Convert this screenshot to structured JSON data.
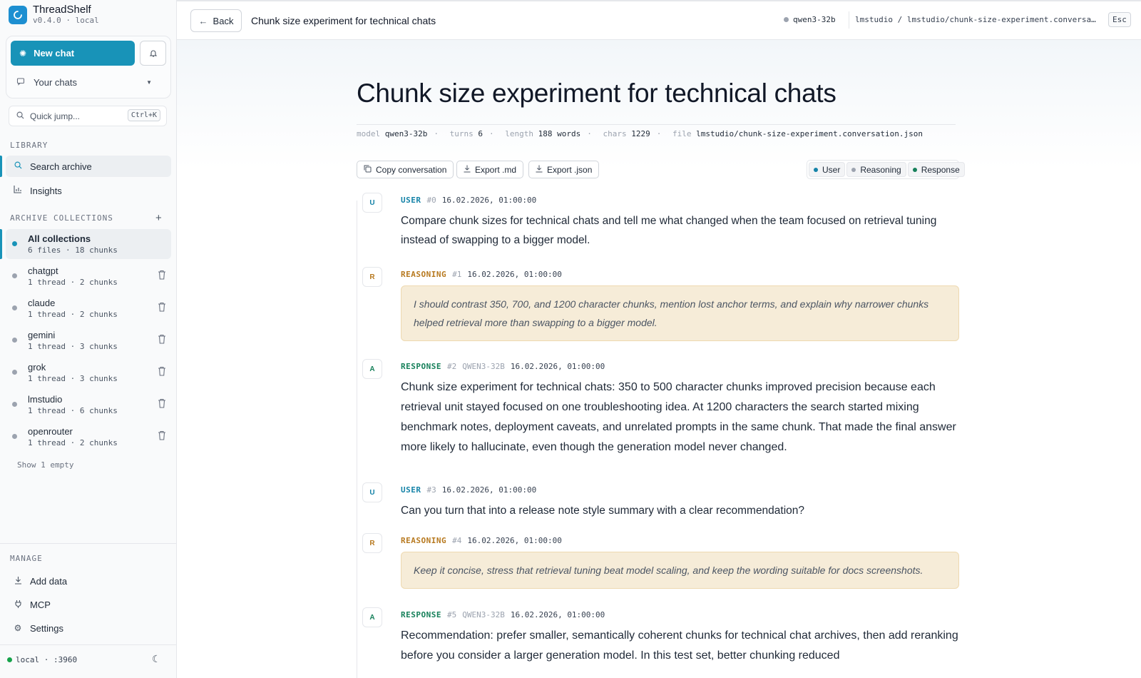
{
  "app": {
    "name": "ThreadShelf",
    "version": "v0.4.0 · local"
  },
  "sidebar": {
    "new_chat": "New chat",
    "your_chats": "Your chats",
    "quick_jump": {
      "placeholder": "Quick jump...",
      "shortcut": "Ctrl+K"
    },
    "library_label": "LIBRARY",
    "library": [
      {
        "label": "Search archive",
        "icon": "search-icon"
      },
      {
        "label": "Insights",
        "icon": "chart-icon"
      }
    ],
    "collections_label": "ARCHIVE COLLECTIONS",
    "collections": [
      {
        "name": "All collections",
        "meta": "6 files · 18 chunks"
      },
      {
        "name": "chatgpt",
        "meta": "1 thread · 2 chunks"
      },
      {
        "name": "claude",
        "meta": "1 thread · 2 chunks"
      },
      {
        "name": "gemini",
        "meta": "1 thread · 3 chunks"
      },
      {
        "name": "grok",
        "meta": "1 thread · 3 chunks"
      },
      {
        "name": "lmstudio",
        "meta": "1 thread · 6 chunks"
      },
      {
        "name": "openrouter",
        "meta": "1 thread · 2 chunks"
      }
    ],
    "show_empty": "Show 1 empty",
    "manage_label": "MANAGE",
    "manage": [
      {
        "label": "Add data",
        "icon": "download-icon"
      },
      {
        "label": "MCP",
        "icon": "plug-icon"
      },
      {
        "label": "Settings",
        "icon": "gear-icon"
      }
    ],
    "status": "local · :3960"
  },
  "topbar": {
    "back": "Back",
    "title": "Chunk size experiment for technical chats",
    "model": "qwen3-32b",
    "path": "lmstudio / lmstudio/chunk-size-experiment.conversati…",
    "esc": "Esc"
  },
  "conversation": {
    "title": "Chunk size experiment for technical chats",
    "meta": {
      "model_label": "model",
      "model": "qwen3-32b",
      "turns_label": "turns",
      "turns": "6",
      "length_label": "length",
      "length": "188 words",
      "chars_label": "chars",
      "chars": "1229",
      "file_label": "file",
      "file": "lmstudio/chunk-size-experiment.conversation.json"
    },
    "actions": {
      "copy": "Copy conversation",
      "export_md": "Export .md",
      "export_json": "Export .json"
    },
    "filters": {
      "user": "User",
      "reasoning": "Reasoning",
      "response": "Response"
    },
    "colors": {
      "user": "#1583a8",
      "reasoning": "#b7791f",
      "response": "#16805a"
    },
    "messages": [
      {
        "avatar": "U",
        "role": "USER",
        "num": "#0",
        "model": "",
        "ts": "16.02.2026, 01:00:00",
        "text": "Compare chunk sizes for technical chats and tell me what changed when the team focused on retrieval tuning instead of swapping to a bigger model."
      },
      {
        "avatar": "R",
        "role": "REASONING",
        "num": "#1",
        "model": "",
        "ts": "16.02.2026, 01:00:00",
        "text": "I should contrast 350, 700, and 1200 character chunks, mention lost anchor terms, and explain why narrower chunks helped retrieval more than swapping to a bigger model."
      },
      {
        "avatar": "A",
        "role": "RESPONSE",
        "num": "#2",
        "model": "QWEN3-32B",
        "ts": "16.02.2026, 01:00:00",
        "text": "Chunk size experiment for technical chats: 350 to 500 character chunks improved precision because each retrieval unit stayed focused on one troubleshooting idea. At 1200 characters the search started mixing benchmark notes, deployment caveats, and unrelated prompts in the same chunk. That made the final answer more likely to hallucinate, even though the generation model never changed."
      },
      {
        "avatar": "U",
        "role": "USER",
        "num": "#3",
        "model": "",
        "ts": "16.02.2026, 01:00:00",
        "text": "Can you turn that into a release note style summary with a clear recommendation?"
      },
      {
        "avatar": "R",
        "role": "REASONING",
        "num": "#4",
        "model": "",
        "ts": "16.02.2026, 01:00:00",
        "text": "Keep it concise, stress that retrieval tuning beat model scaling, and keep the wording suitable for docs screenshots."
      },
      {
        "avatar": "A",
        "role": "RESPONSE",
        "num": "#5",
        "model": "QWEN3-32B",
        "ts": "16.02.2026, 01:00:00",
        "text": "Recommendation: prefer smaller, semantically coherent chunks for technical chat archives, then add reranking before you consider a larger generation model. In this test set, better chunking reduced"
      }
    ]
  }
}
